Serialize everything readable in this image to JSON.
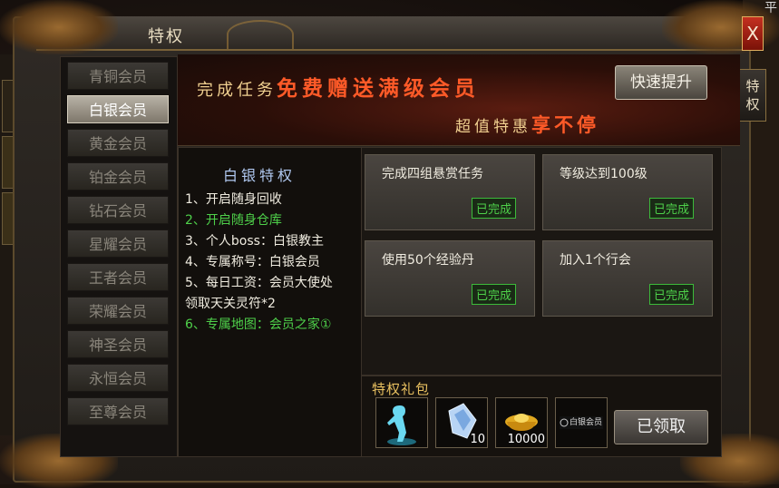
{
  "window": {
    "title": "特权",
    "close_label": "X",
    "side_tab_label": "特\n权",
    "corner_text": "平"
  },
  "menu": {
    "items": [
      {
        "label": "青铜会员",
        "active": false
      },
      {
        "label": "白银会员",
        "active": true
      },
      {
        "label": "黄金会员",
        "active": false
      },
      {
        "label": "铂金会员",
        "active": false
      },
      {
        "label": "钻石会员",
        "active": false
      },
      {
        "label": "星耀会员",
        "active": false
      },
      {
        "label": "王者会员",
        "active": false
      },
      {
        "label": "荣耀会员",
        "active": false
      },
      {
        "label": "神圣会员",
        "active": false
      },
      {
        "label": "永恒会员",
        "active": false
      },
      {
        "label": "至尊会员",
        "active": false
      }
    ]
  },
  "banner": {
    "line1_prefix": "完成任务",
    "line1_highlight": "免费赠送满级会员",
    "line2_prefix": "超值特惠",
    "line2_highlight": "享不停",
    "fast_button": "快速提升"
  },
  "privileges": {
    "title": "白银特权",
    "lines": [
      {
        "text": "1、开启随身回收",
        "color": "white"
      },
      {
        "text": "2、开启随身仓库",
        "color": "green"
      },
      {
        "text": "3、个人boss：白银教主",
        "color": "white"
      },
      {
        "text": "4、专属称号：白银会员",
        "color": "white"
      },
      {
        "text": "5、每日工资：会员大使处",
        "color": "white"
      },
      {
        "text": "领取天关灵符*2",
        "color": "white"
      },
      {
        "text": "6、专属地图：会员之家①",
        "color": "green"
      }
    ]
  },
  "tasks": [
    {
      "label": "完成四组悬赏任务",
      "status": "已完成"
    },
    {
      "label": "等级达到100级",
      "status": "已完成"
    },
    {
      "label": "使用50个经验丹",
      "status": "已完成"
    },
    {
      "label": "加入1个行会",
      "status": "已完成"
    }
  ],
  "gift": {
    "label": "特权礼包",
    "items": [
      {
        "icon": "spirit-figure-icon",
        "count": ""
      },
      {
        "icon": "crystal-icon",
        "count": "10"
      },
      {
        "icon": "gold-ingot-icon",
        "count": "10000"
      },
      {
        "icon": "silver-member-title-icon",
        "count": "",
        "title_text": "白银会员"
      }
    ],
    "claim_button": "已领取"
  },
  "colors": {
    "green": "#4ed04a",
    "accent_red": "#ff5a28",
    "gold": "#f0d090"
  }
}
